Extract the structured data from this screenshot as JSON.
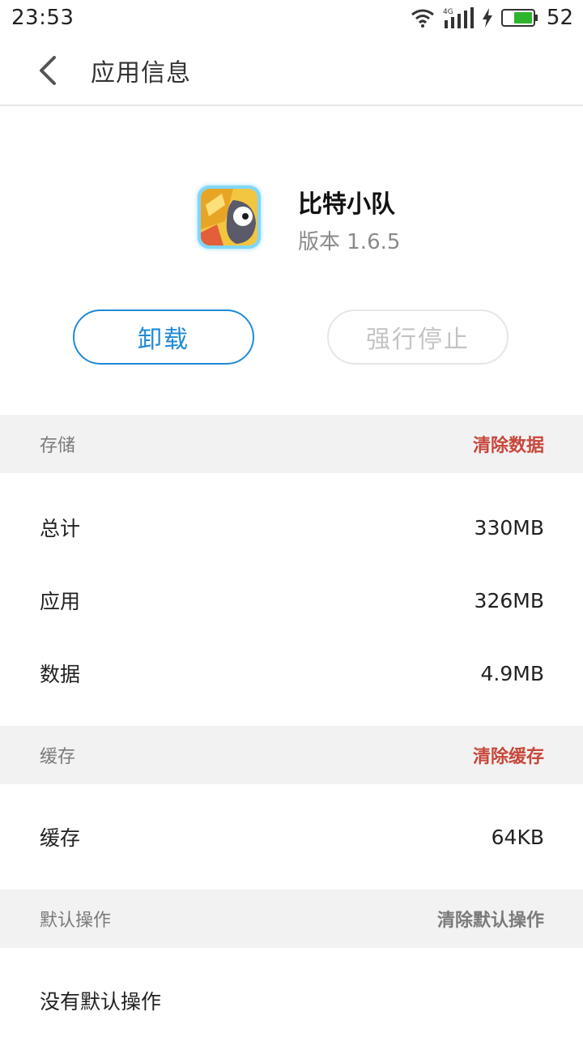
{
  "status_bar": {
    "time": "23:53",
    "network": "4G",
    "battery": "52",
    "icons": [
      "wifi-icon",
      "signal-icon",
      "charging-icon",
      "battery-icon"
    ],
    "battery_color": "#2db52d"
  },
  "title_bar": {
    "title": "应用信息",
    "back_icon": "chevron-left-icon"
  },
  "app": {
    "name": "比特小队",
    "version": "版本 1.6.5"
  },
  "buttons": {
    "uninstall": "卸载",
    "force_stop": "强行停止"
  },
  "storage": {
    "title": "存储",
    "action": "清除数据",
    "rows": [
      {
        "label": "总计",
        "value": "330MB"
      },
      {
        "label": "应用",
        "value": "326MB"
      },
      {
        "label": "数据",
        "value": "4.9MB"
      }
    ]
  },
  "cache": {
    "title": "缓存",
    "action": "清除缓存",
    "rows": [
      {
        "label": "缓存",
        "value": "64KB"
      }
    ]
  },
  "defaults": {
    "title": "默认操作",
    "action": "清除默认操作",
    "rows": [
      {
        "label": "没有默认操作"
      }
    ]
  },
  "colors": {
    "accent_blue": "#1f8ad6",
    "action_red": "#c8473b",
    "section_bg": "#f2f2f2"
  }
}
